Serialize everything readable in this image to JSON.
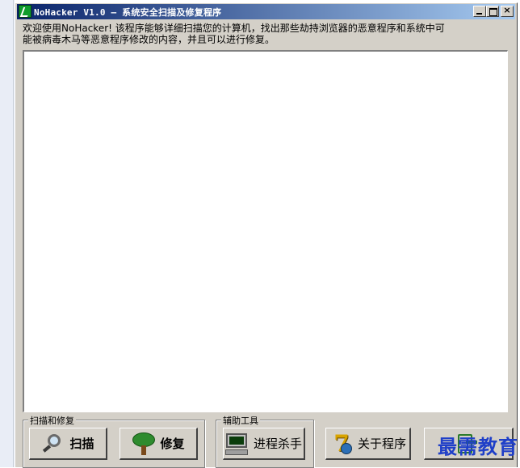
{
  "window": {
    "title": "NoHacker V1.0 — 系统安全扫描及修复程序",
    "controls": {
      "minimize": "_",
      "maximize": "□",
      "close": "×"
    }
  },
  "intro": {
    "line1": "欢迎使用NoHacker! 该程序能够详细扫描您的计算机，找出那些劫持浏览器的恶意程序和系统中可",
    "line2": "能被病毒木马等恶意程序修改的内容，并且可以进行修复。"
  },
  "results": {
    "items": []
  },
  "groups": {
    "scan_repair": {
      "label": "扫描和修复",
      "scan": {
        "label": "扫描",
        "icon": "magnifier-icon"
      },
      "repair": {
        "label": "修复",
        "icon": "tree-icon"
      }
    },
    "tools": {
      "label": "辅助工具",
      "process_killer": {
        "label": "进程杀手",
        "icon": "computer-monitor-icon"
      }
    }
  },
  "about": {
    "label": "关于程序",
    "icon": "seven-globe-icon"
  },
  "exit": {
    "label": "",
    "icon": "exit-icon"
  },
  "watermark": {
    "text": "最需教育"
  },
  "colors": {
    "titlebar_start": "#0a246a",
    "titlebar_end": "#a6caf0",
    "face": "#d4d0c8",
    "watermark": "#1f3fc8"
  }
}
